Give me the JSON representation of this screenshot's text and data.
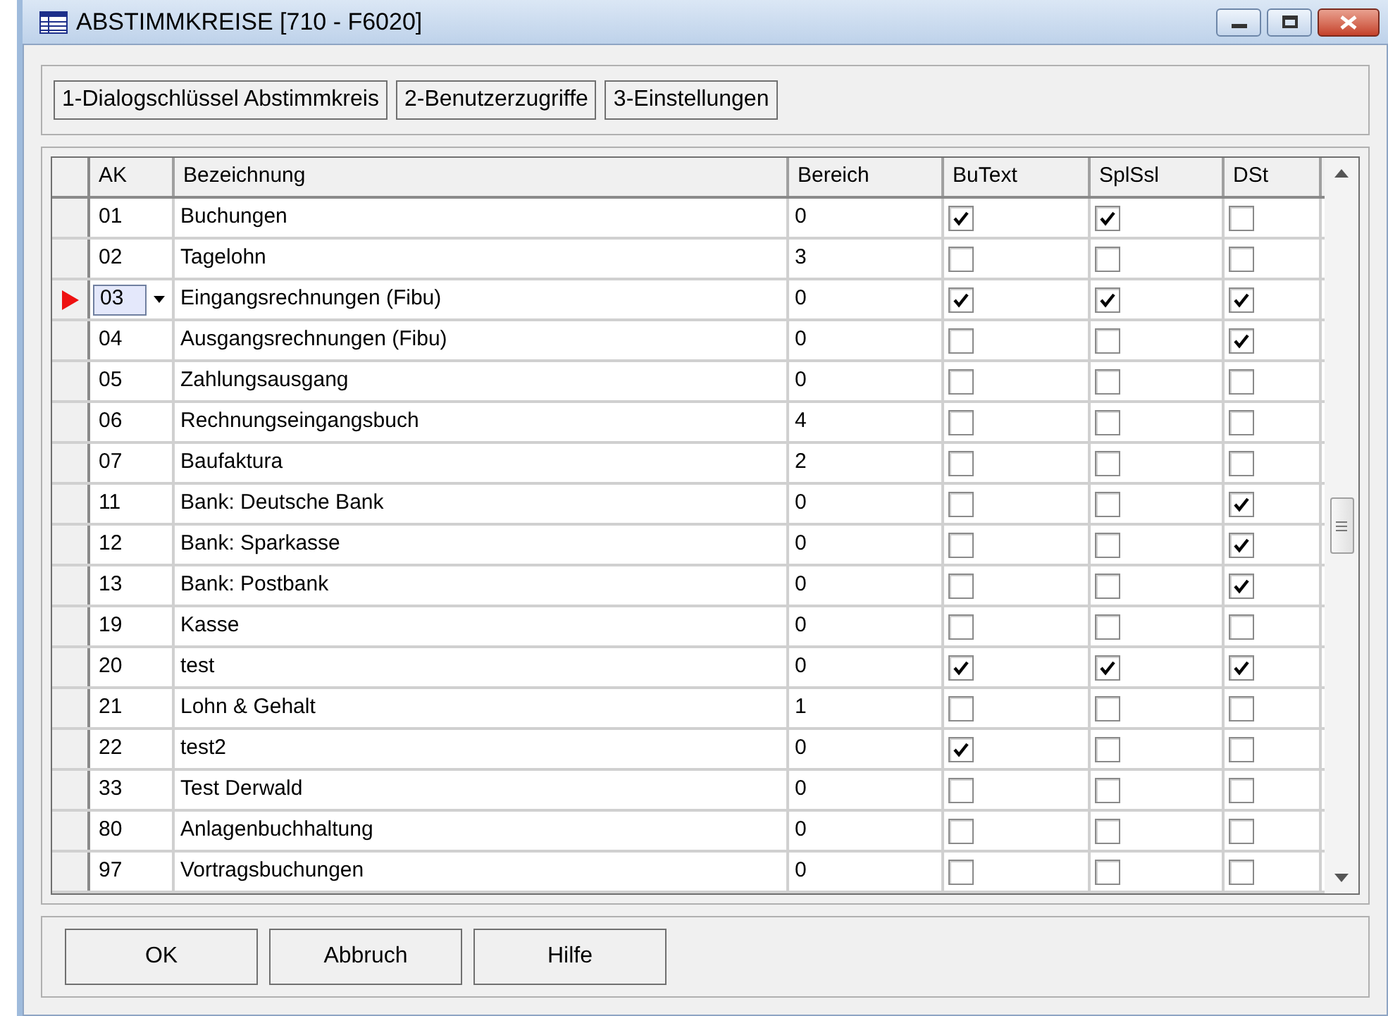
{
  "window": {
    "title": "ABSTIMMKREISE  [710 - F6020]"
  },
  "tabs": [
    {
      "label": "1-Dialogschlüssel Abstimmkreis"
    },
    {
      "label": "2-Benutzerzugriffe"
    },
    {
      "label": "3-Einstellungen"
    }
  ],
  "table": {
    "columns": [
      "AK",
      "Bezeichnung",
      "Bereich",
      "BuText",
      "SplSsl",
      "DSt"
    ],
    "rows": [
      {
        "ak": "01",
        "bezeichnung": "Buchungen",
        "bereich": "0",
        "butext": true,
        "splssl": true,
        "dst": false,
        "current": false
      },
      {
        "ak": "02",
        "bezeichnung": "Tagelohn",
        "bereich": "3",
        "butext": false,
        "splssl": false,
        "dst": false,
        "current": false
      },
      {
        "ak": "03",
        "bezeichnung": "Eingangsrechnungen (Fibu)",
        "bereich": "0",
        "butext": true,
        "splssl": true,
        "dst": true,
        "current": true
      },
      {
        "ak": "04",
        "bezeichnung": "Ausgangsrechnungen (Fibu)",
        "bereich": "0",
        "butext": false,
        "splssl": false,
        "dst": true,
        "current": false
      },
      {
        "ak": "05",
        "bezeichnung": "Zahlungsausgang",
        "bereich": "0",
        "butext": false,
        "splssl": false,
        "dst": false,
        "current": false
      },
      {
        "ak": "06",
        "bezeichnung": "Rechnungseingangsbuch",
        "bereich": "4",
        "butext": false,
        "splssl": false,
        "dst": false,
        "current": false
      },
      {
        "ak": "07",
        "bezeichnung": "Baufaktura",
        "bereich": "2",
        "butext": false,
        "splssl": false,
        "dst": false,
        "current": false
      },
      {
        "ak": "11",
        "bezeichnung": "Bank: Deutsche Bank",
        "bereich": "0",
        "butext": false,
        "splssl": false,
        "dst": true,
        "current": false
      },
      {
        "ak": "12",
        "bezeichnung": "Bank: Sparkasse",
        "bereich": "0",
        "butext": false,
        "splssl": false,
        "dst": true,
        "current": false
      },
      {
        "ak": "13",
        "bezeichnung": "Bank: Postbank",
        "bereich": "0",
        "butext": false,
        "splssl": false,
        "dst": true,
        "current": false
      },
      {
        "ak": "19",
        "bezeichnung": "Kasse",
        "bereich": "0",
        "butext": false,
        "splssl": false,
        "dst": false,
        "current": false
      },
      {
        "ak": "20",
        "bezeichnung": "test",
        "bereich": "0",
        "butext": true,
        "splssl": true,
        "dst": true,
        "current": false
      },
      {
        "ak": "21",
        "bezeichnung": "Lohn & Gehalt",
        "bereich": "1",
        "butext": false,
        "splssl": false,
        "dst": false,
        "current": false
      },
      {
        "ak": "22",
        "bezeichnung": "test2",
        "bereich": "0",
        "butext": true,
        "splssl": false,
        "dst": false,
        "current": false
      },
      {
        "ak": "33",
        "bezeichnung": "Test Derwald",
        "bereich": "0",
        "butext": false,
        "splssl": false,
        "dst": false,
        "current": false
      },
      {
        "ak": "80",
        "bezeichnung": "Anlagenbuchhaltung",
        "bereich": "0",
        "butext": false,
        "splssl": false,
        "dst": false,
        "current": false
      },
      {
        "ak": "97",
        "bezeichnung": "Vortragsbuchungen",
        "bereich": "0",
        "butext": false,
        "splssl": false,
        "dst": false,
        "current": false
      }
    ]
  },
  "buttons": [
    "OK",
    "Abbruch",
    "Hilfe"
  ]
}
